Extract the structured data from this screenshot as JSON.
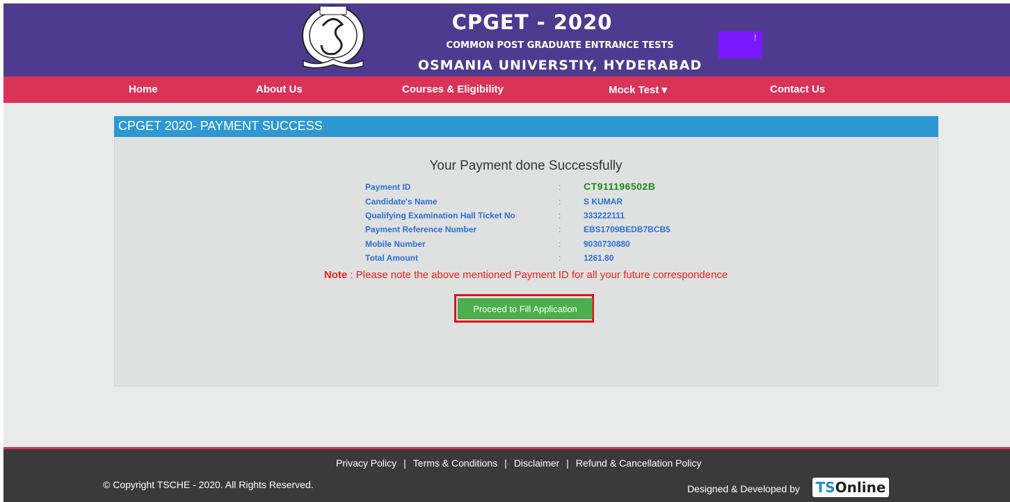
{
  "header": {
    "logo_alt": "Osmania University",
    "title": "CPGET - 2020",
    "subtitle": "COMMON POST GRADUATE ENTRANCE TESTS",
    "university": "OSMANIA UNIVERSTIY, HYDERABAD",
    "badge_text": "!"
  },
  "nav": {
    "items": [
      {
        "label": "Home"
      },
      {
        "label": "About Us"
      },
      {
        "label": "Courses & Eligibility"
      },
      {
        "label": "Mock Test ▾"
      },
      {
        "label": "Contact Us"
      }
    ]
  },
  "panel": {
    "heading": "CPGET 2020- PAYMENT SUCCESS",
    "message": "Your Payment done Successfully",
    "rows": [
      {
        "label": "Payment ID",
        "colon": ":",
        "value": "CT911196502B"
      },
      {
        "label": "Candidate's Name",
        "colon": ":",
        "value": "S KUMAR"
      },
      {
        "label": "Qualifying Examination Hall Ticket No",
        "colon": ":",
        "value": "333222111"
      },
      {
        "label": "Payment Reference Number",
        "colon": ":",
        "value": "EBS1709BEDB7BCB5"
      },
      {
        "label": "Mobile Number",
        "colon": ":",
        "value": "9030730880"
      },
      {
        "label": "Total Amount",
        "colon": ":",
        "value": "1261.80"
      }
    ],
    "note_label": "Note",
    "note_text": " : Please note the above mentioned Payment ID for all your future correspondence",
    "button_label": "Proceed to Fill Application"
  },
  "footer": {
    "links": [
      "Privacy Policy",
      "Terms & Conditions",
      "Disclaimer",
      "Refund & Cancellation Policy"
    ],
    "separator": "|",
    "copyright": "© Copyright TSCHE - 2020. All Rights Reserved.",
    "designed_by": "Designed & Developed by",
    "brand_ts": "TS",
    "brand_online": "Online"
  },
  "colors": {
    "header_bg": "#4e3b8f",
    "nav_bg": "#d93357",
    "panel_head_bg": "#2e98d3",
    "button_bg": "#4cae4c",
    "highlight_border": "#e2101c",
    "note_color": "#e8231a"
  }
}
